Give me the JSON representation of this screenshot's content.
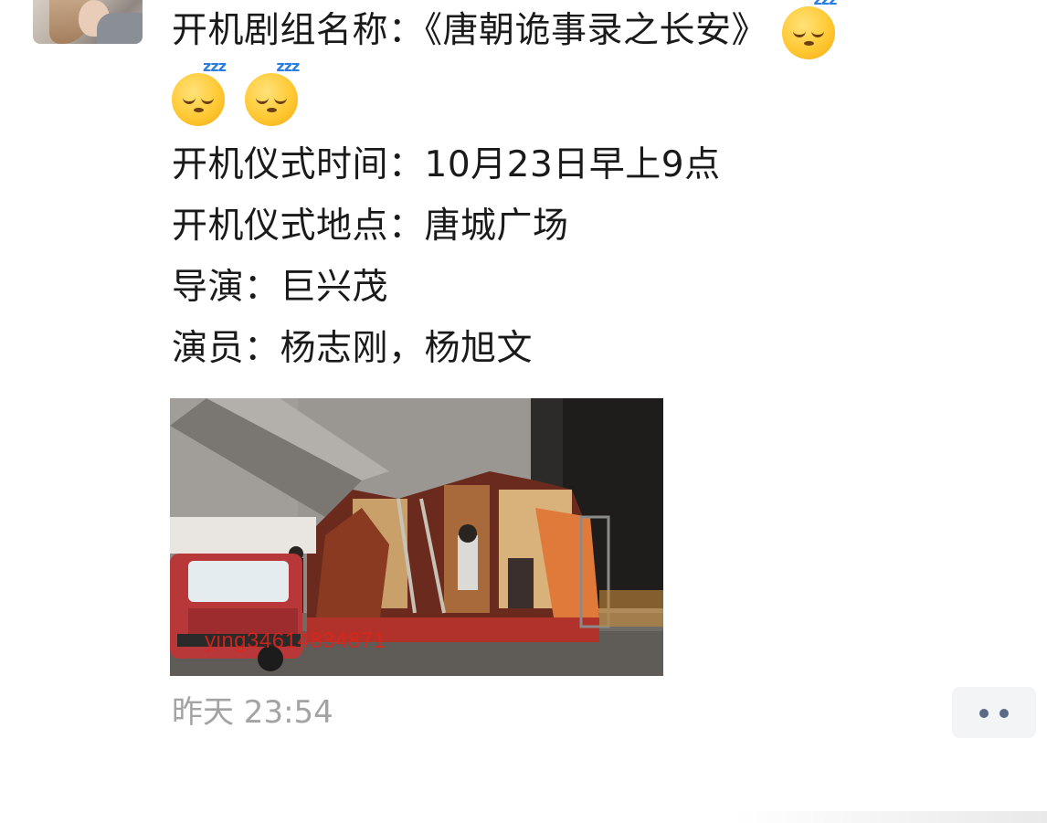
{
  "message": {
    "lines": [
      {
        "label": "开机剧组名称：",
        "value": "《唐朝诡事录之长安》"
      },
      {
        "label": "开机仪式时间：",
        "value": "10月23日早上9点"
      },
      {
        "label": "开机仪式地点：",
        "value": "唐城广场"
      },
      {
        "label": "导演：",
        "value": "巨兴茂"
      },
      {
        "label": "演员：",
        "value": "杨志刚，杨旭文"
      }
    ],
    "emoji_glyph": "zzz"
  },
  "photo": {
    "watermark": "ying34614834871"
  },
  "timestamp": "昨天 23:54",
  "colors": {
    "text": "#1a1a1a",
    "timestamp": "#a3a3a3",
    "watermark": "#e2231a",
    "more_button_bg": "#f3f4f6",
    "more_dots": "#5b6b86"
  },
  "icons": {
    "more": "more-dots-icon",
    "emoji": "sleeping-face-icon",
    "avatar": "avatar"
  }
}
